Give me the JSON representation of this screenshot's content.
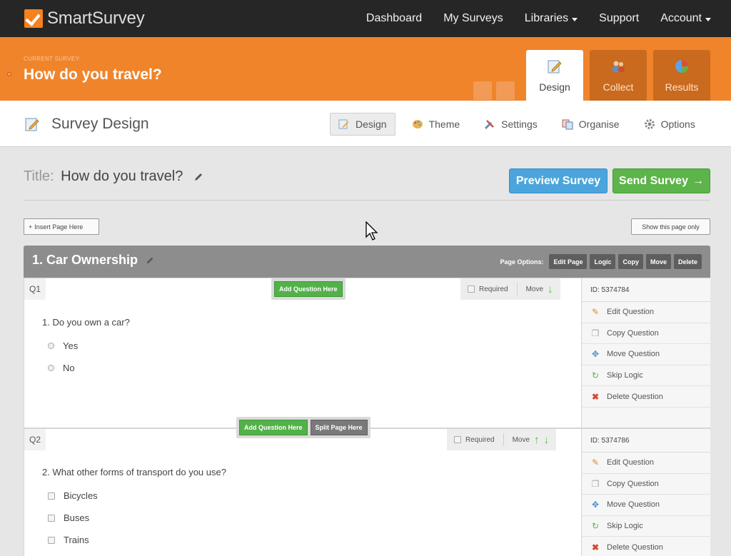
{
  "app": {
    "logo_text": "SmartSurvey"
  },
  "nav": {
    "dashboard": "Dashboard",
    "my_surveys": "My Surveys",
    "libraries": "Libraries",
    "support": "Support",
    "account": "Account"
  },
  "survey_bar": {
    "current_label": "CURRENT SURVEY:",
    "survey_name": "How do you travel?",
    "tabs": {
      "design": "Design",
      "collect": "Collect",
      "results": "Results"
    }
  },
  "subheader": {
    "title": "Survey Design",
    "tabs": {
      "design": "Design",
      "theme": "Theme",
      "settings": "Settings",
      "organise": "Organise",
      "options": "Options"
    }
  },
  "title_row": {
    "label": "Title:",
    "value": "How do you travel?"
  },
  "buttons": {
    "preview": "Preview Survey",
    "send": "Send Survey",
    "insert_page": "Insert Page Here",
    "show_page_only": "Show this page only"
  },
  "page": {
    "title": "1. Car Ownership",
    "options_label": "Page Options:",
    "options": {
      "edit": "Edit Page",
      "logic": "Logic",
      "copy": "Copy",
      "move": "Move",
      "delete": "Delete"
    }
  },
  "questions": [
    {
      "num": "Q1",
      "text": "1. Do you own a car?",
      "options": [
        "Yes",
        "No"
      ],
      "id_text": "ID: 5374784",
      "add_label": "Add Question Here",
      "required_label": "Required",
      "move_label": "Move"
    },
    {
      "num": "Q2",
      "text": "2. What other forms of transport do you use?",
      "options": [
        "Bicycles",
        "Buses",
        "Trains"
      ],
      "id_text": "ID: 5374786",
      "add_label": "Add Question Here",
      "split_label": "Split Page Here",
      "required_label": "Required",
      "move_label": "Move"
    }
  ],
  "side_menu": {
    "edit": "Edit Question",
    "copy": "Copy Question",
    "move": "Move Question",
    "skip": "Skip Logic",
    "delete": "Delete Question"
  },
  "colors": {
    "brand_orange": "#f0842a",
    "nav_dark": "#262626",
    "preview_blue": "#4ba5dc",
    "send_green": "#5cb44a"
  }
}
